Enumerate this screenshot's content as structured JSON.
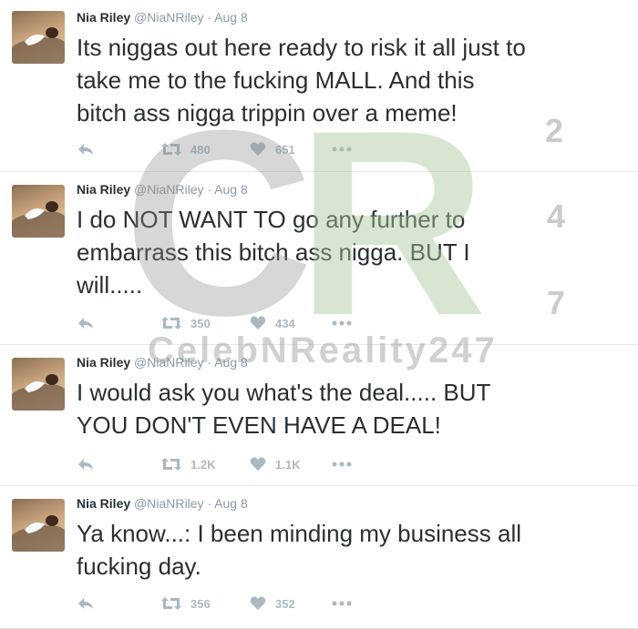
{
  "tweets": [
    {
      "name": "Nia Riley",
      "handle": "@NiaNRiley",
      "separator": "·",
      "date": "Aug 8",
      "text": "Its niggas out here ready to risk it all just to\ntake me to the fucking MALL. And this\nbitch ass nigga trippin over a meme!",
      "retweets": "480",
      "likes": "651"
    },
    {
      "name": "Nia Riley",
      "handle": "@NiaNRiley",
      "separator": "·",
      "date": "Aug 8",
      "text": "I do NOT WANT TO go any further to\nembarrass this bitch ass nigga. BUT I\nwill.....",
      "retweets": "350",
      "likes": "434"
    },
    {
      "name": "Nia Riley",
      "handle": "@NiaNRiley",
      "separator": "·",
      "date": "Aug 8",
      "text": "I would ask you what's the deal..... BUT\nYOU DON'T EVEN HAVE A DEAL!",
      "retweets": "1.2K",
      "likes": "1.1K"
    },
    {
      "name": "Nia Riley",
      "handle": "@NiaNRiley",
      "separator": "·",
      "date": "Aug 8",
      "text": "Ya know...: I been minding my business all\nfucking day.",
      "retweets": "356",
      "likes": "352"
    }
  ],
  "watermark": {
    "letter_c": "C",
    "letter_r": "R",
    "digit_2": "2",
    "digit_4": "4",
    "digit_7": "7",
    "text": "CelebNReality247",
    "color_c": "#8c8c8c",
    "color_r": "#a9c79a"
  }
}
